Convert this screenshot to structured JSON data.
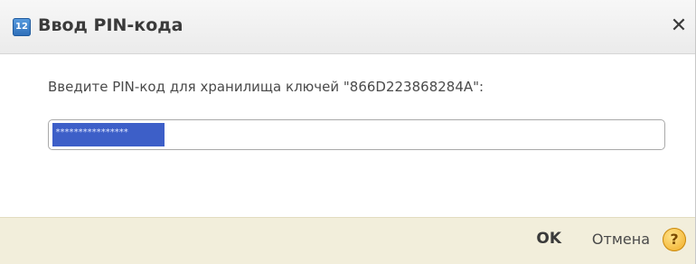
{
  "window": {
    "title": "Ввод PIN-кода",
    "app_icon_text": "12",
    "close_label": "✕"
  },
  "form": {
    "prompt": "Введите PIN-код для хранилища ключей \"866D223868284A\":",
    "pin_value": "****************"
  },
  "footer": {
    "ok_label": "OK",
    "cancel_label": "Отмена",
    "help_label": "?"
  },
  "colors": {
    "selection": "#3d5fc8",
    "footer_bg": "#f2eedb",
    "help_icon": "#f0a91e"
  }
}
